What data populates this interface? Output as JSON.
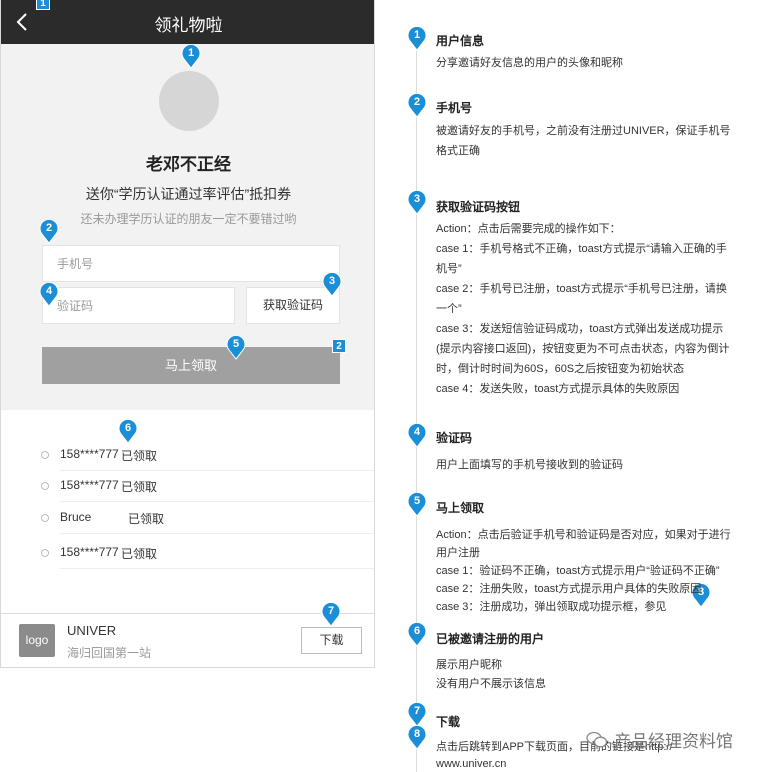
{
  "app": {
    "title": "领礼物啦",
    "corner_tags": [
      "1",
      "2"
    ]
  },
  "hero": {
    "nickname": "老邓不正经",
    "gift_text": "送你“学历认证通过率评估”抵扣券",
    "sub_text": "还未办理学历认证的朋友一定不要错过哟",
    "phone_placeholder": "手机号",
    "code_placeholder": "验证码",
    "code_button": "获取验证码",
    "claim_button": "马上领取"
  },
  "list": [
    {
      "name": "158****777",
      "status": "已领取"
    },
    {
      "name": "158****777",
      "status": "已领取"
    },
    {
      "name": "Bruce",
      "status": "已领取"
    },
    {
      "name": "158****777",
      "status": "已领取"
    }
  ],
  "footer": {
    "logo": "logo",
    "brand": "UNIVER",
    "slogan": "海归回国第一站",
    "download": "下载"
  },
  "pins": [
    "1",
    "2",
    "3",
    "4",
    "5",
    "6",
    "7",
    "8"
  ],
  "annotations": [
    {
      "num": "1",
      "title": "用户信息",
      "lines": [
        "分享邀请好友信息的用户的头像和昵称"
      ]
    },
    {
      "num": "2",
      "title": "手机号",
      "lines": [
        "被邀请好友的手机号，之前没有注册过UNIVER，保证手机号",
        "格式正确"
      ]
    },
    {
      "num": "3",
      "title": "获取验证码按钮",
      "lines": [
        "Action：点击后需要完成的操作如下：",
        "case 1：手机号格式不正确，toast方式提示“请输入正确的手",
        "机号”",
        "case 2：手机号已注册，toast方式提示“手机号已注册，请换",
        "一个”",
        "case 3：发送短信验证码成功，toast方式弹出发送成功提示",
        "(提示内容接口返回)，按钮变更为不可点击状态，内容为倒计",
        "时，倒计时时间为60S，60S之后按钮变为初始状态",
        "case 4：发送失败，toast方式提示具体的失败原因"
      ]
    },
    {
      "num": "4",
      "title": "验证码",
      "lines": [
        "用户上面填写的手机号接收到的验证码"
      ]
    },
    {
      "num": "5",
      "title": "马上领取",
      "lines": [
        "Action：点击后验证手机号和验证码是否对应，如果对于进行",
        "用户注册",
        "case 1：验证码不正确，toast方式提示用户“验证码不正确”",
        "case 2：注册失败，toast方式提示用户具体的失败原因",
        "case 3：注册成功，弹出领取成功提示框，参见"
      ]
    },
    {
      "num": "6",
      "title": "已被邀请注册的用户",
      "lines": [
        "展示用户昵称",
        "没有用户不展示该信息"
      ]
    },
    {
      "num": "7",
      "title": "下载",
      "lines": []
    },
    {
      "num": "8",
      "title": "",
      "lines": [
        "点击后跳转到APP下载页面，目前的链接是http://",
        "www.univer.cn"
      ]
    }
  ],
  "watermark": {
    "text": "产品经理资料馆",
    "icon": "wechat-icon"
  },
  "colors": {
    "accent": "#1a8fd8",
    "topbar": "#2b2b2b",
    "button_gray": "#a0a0a0"
  }
}
